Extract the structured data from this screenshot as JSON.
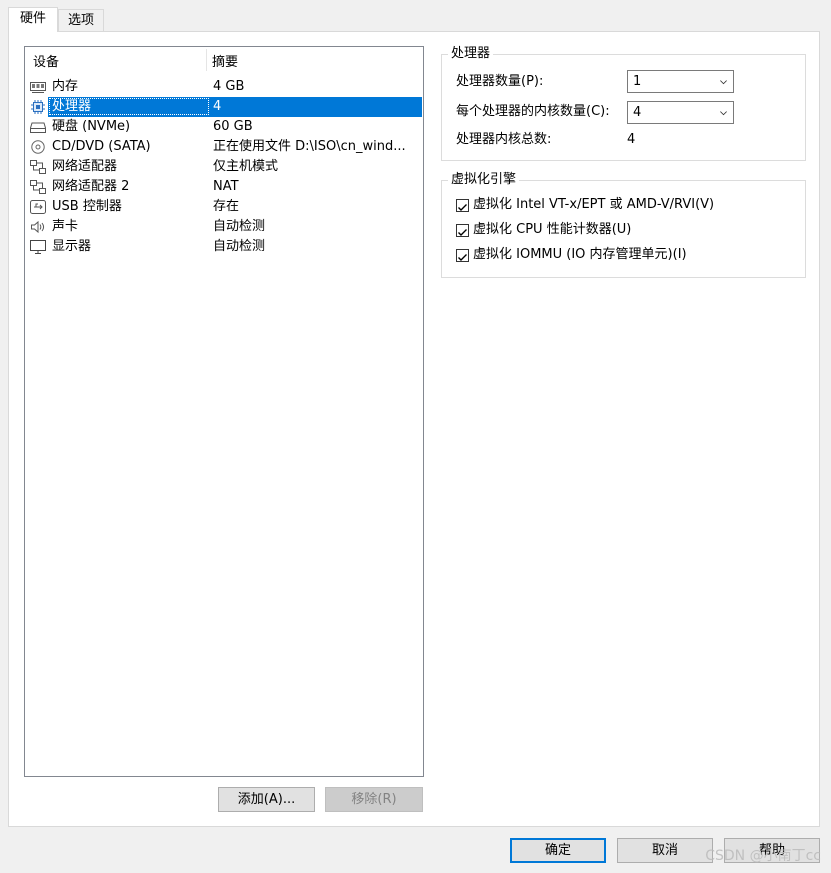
{
  "tabs": [
    {
      "label": "硬件"
    },
    {
      "label": "选项"
    }
  ],
  "device_list": {
    "headers": {
      "device": "设备",
      "summary": "摘要"
    },
    "rows": [
      {
        "name": "内存",
        "summary": "4 GB",
        "icon": "memory-icon"
      },
      {
        "name": "处理器",
        "summary": "4",
        "icon": "cpu-icon",
        "selected": true
      },
      {
        "name": "硬盘 (NVMe)",
        "summary": "60 GB",
        "icon": "hard-disk-icon"
      },
      {
        "name": "CD/DVD (SATA)",
        "summary": "正在使用文件 D:\\ISO\\cn_wind...",
        "icon": "cd-dvd-icon"
      },
      {
        "name": "网络适配器",
        "summary": "仅主机模式",
        "icon": "network-adapter-icon"
      },
      {
        "name": "网络适配器 2",
        "summary": "NAT",
        "icon": "network-adapter-icon"
      },
      {
        "name": "USB 控制器",
        "summary": "存在",
        "icon": "usb-icon"
      },
      {
        "name": "声卡",
        "summary": "自动检测",
        "icon": "sound-card-icon"
      },
      {
        "name": "显示器",
        "summary": "自动检测",
        "icon": "display-icon"
      }
    ]
  },
  "list_buttons": {
    "add": "添加(A)...",
    "remove": "移除(R)"
  },
  "processor_group": {
    "title": "处理器",
    "count_label": "处理器数量(P):",
    "count_value": "1",
    "cores_label": "每个处理器的内核数量(C):",
    "cores_value": "4",
    "total_label": "处理器内核总数:",
    "total_value": "4"
  },
  "virtualization_group": {
    "title": "虚拟化引擎",
    "options": [
      {
        "label": "虚拟化 Intel VT-x/EPT 或 AMD-V/RVI(V)",
        "checked": true
      },
      {
        "label": "虚拟化 CPU 性能计数器(U)",
        "checked": true
      },
      {
        "label": "虚拟化 IOMMU (IO 内存管理单元)(I)",
        "checked": true
      }
    ]
  },
  "dialog_buttons": {
    "ok": "确定",
    "cancel": "取消",
    "help": "帮助"
  },
  "watermark": "CSDN @小南丁cc",
  "colors": {
    "selection": "#0078d7",
    "background": "#f0f0f0"
  }
}
